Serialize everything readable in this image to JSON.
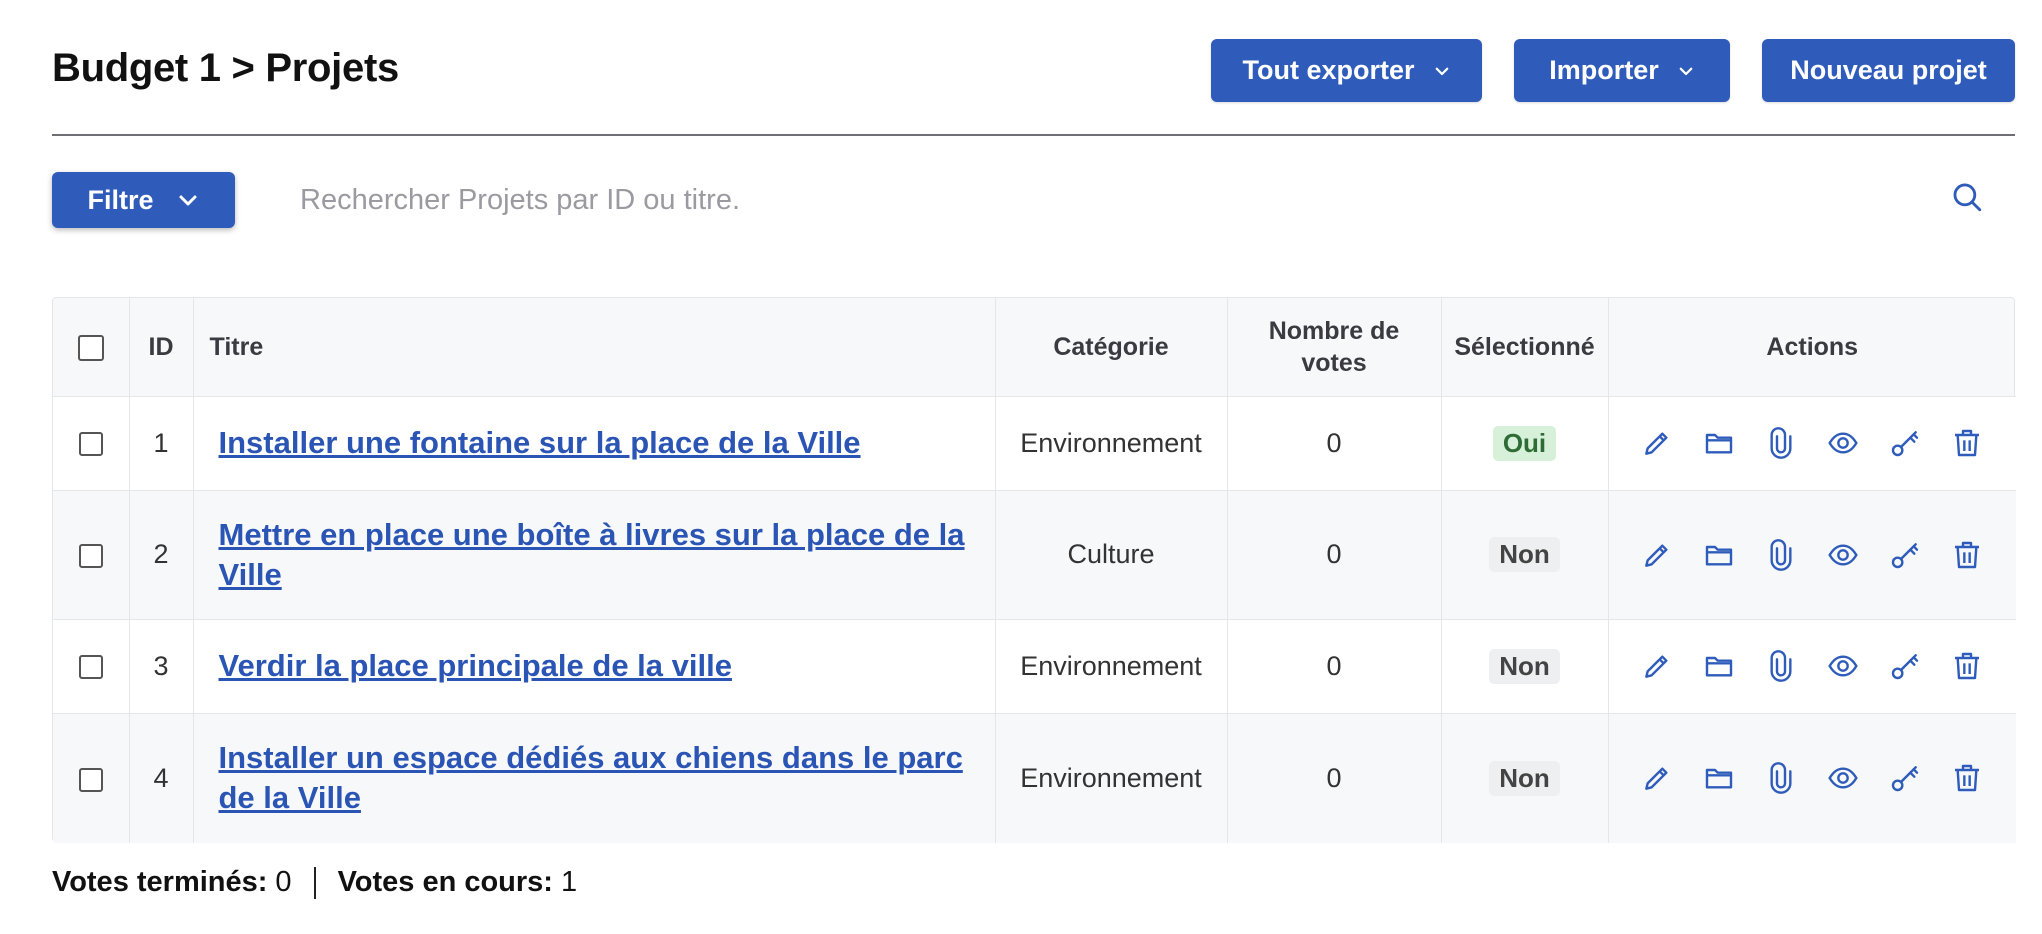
{
  "header": {
    "title": "Budget 1 > Projets",
    "export_label": "Tout exporter",
    "import_label": "Importer",
    "new_label": "Nouveau projet"
  },
  "filter": {
    "label": "Filtre",
    "search_placeholder": "Rechercher Projets par ID ou titre."
  },
  "table": {
    "columns": [
      "ID",
      "Titre",
      "Catégorie",
      "Nombre de votes",
      "Sélectionné",
      "Actions"
    ],
    "rows": [
      {
        "id": "1",
        "title": "Installer une fontaine sur la place de la Ville",
        "category": "Environnement",
        "votes": "0",
        "selected": "Oui"
      },
      {
        "id": "2",
        "title": "Mettre en place une boîte à livres sur la place de la Ville",
        "category": "Culture",
        "votes": "0",
        "selected": "Non"
      },
      {
        "id": "3",
        "title": "Verdir la place principale de la ville",
        "category": "Environnement",
        "votes": "0",
        "selected": "Non"
      },
      {
        "id": "4",
        "title": "Installer un espace dédiés aux chiens dans le parc de la Ville",
        "category": "Environnement",
        "votes": "0",
        "selected": "Non"
      }
    ],
    "action_icons": [
      "pencil-icon",
      "folder-icon",
      "paperclip-icon",
      "eye-icon",
      "key-icon",
      "trash-icon"
    ]
  },
  "footer": {
    "finished_label": "Votes terminés:",
    "finished_value": "0",
    "ongoing_label": "Votes en cours:",
    "ongoing_value": "1"
  },
  "colors": {
    "primary": "#2f5cba",
    "link": "#2b55b4",
    "badge_yes_bg": "#d7f0d9",
    "badge_no_bg": "#eeeff1"
  }
}
